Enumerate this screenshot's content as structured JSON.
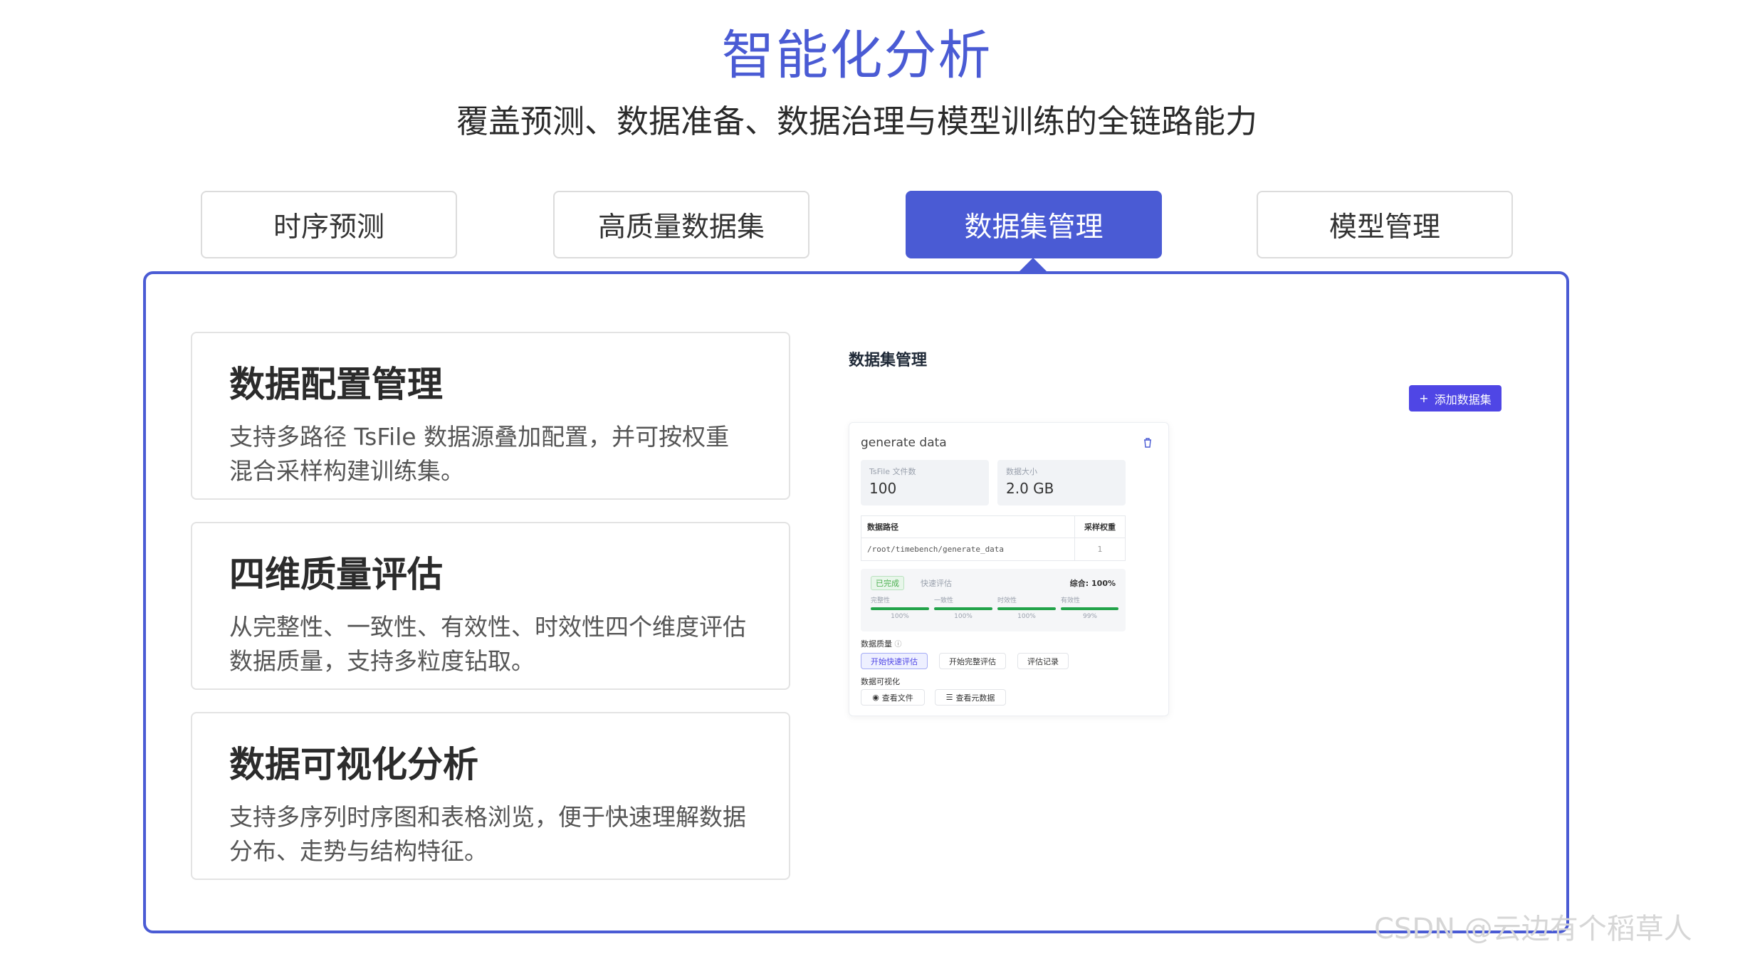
{
  "header": {
    "title": "智能化分析",
    "subtitle": "覆盖预测、数据准备、数据治理与模型训练的全链路能力"
  },
  "tabs": [
    {
      "label": "时序预测"
    },
    {
      "label": "高质量数据集"
    },
    {
      "label": "数据集管理"
    },
    {
      "label": "模型管理"
    }
  ],
  "active_tab": 2,
  "features": [
    {
      "title": "数据配置管理",
      "desc": "支持多路径 TsFile 数据源叠加配置，并可按权重混合采样构建训练集。"
    },
    {
      "title": "四维质量评估",
      "desc": "从完整性、一致性、有效性、时效性四个维度评估数据质量，支持多粒度钻取。"
    },
    {
      "title": "数据可视化分析",
      "desc": "支持多序列时序图和表格浏览，便于快速理解数据分布、走势与结构特征。"
    }
  ],
  "mockup": {
    "page_title": "数据集管理",
    "add_button": "添加数据集",
    "dataset": {
      "name": "generate data",
      "stats": [
        {
          "label": "TsFile 文件数",
          "value": "100"
        },
        {
          "label": "数据大小",
          "value": "2.0 GB"
        }
      ],
      "table": {
        "headers": [
          "数据路径",
          "采样权重"
        ],
        "rows": [
          [
            "/root/timebench/generate_data",
            "1"
          ]
        ]
      },
      "quality": {
        "status": "已完成",
        "type": "快速评估",
        "overall": "综合: 100%",
        "metrics": [
          {
            "name": "完整性",
            "value": "100%",
            "fill": 1.0
          },
          {
            "name": "一致性",
            "value": "100%",
            "fill": 1.0
          },
          {
            "name": "时效性",
            "value": "100%",
            "fill": 1.0
          },
          {
            "name": "有效性",
            "value": "99%",
            "fill": 0.99
          }
        ]
      },
      "quality_label": "数据质量",
      "quality_buttons": [
        "开始快速评估",
        "开始完整评估",
        "评估记录"
      ],
      "viz_label": "数据可视化",
      "viz_buttons": [
        "查看文件",
        "查看元数据"
      ]
    }
  },
  "watermark": "CSDN @云边有个稻草人",
  "colors": {
    "accent": "#4a5bd4",
    "button": "#4f46e5",
    "success": "#22a34a"
  }
}
